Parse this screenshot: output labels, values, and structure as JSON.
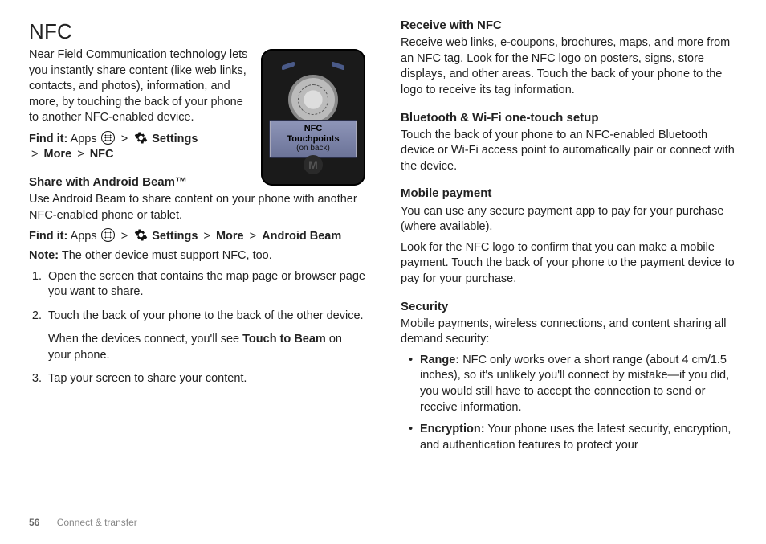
{
  "left": {
    "h1": "NFC",
    "intro": "Near Field Communication technology lets you instantly share content (like web links, contacts, and photos), information, and more, by touching the back of your phone to another NFC-enabled device.",
    "find1_label": "Find it:",
    "find1_apps": "Apps",
    "find1_settings": "Settings",
    "find1_more": "More",
    "find1_nfc": "NFC",
    "h2_beam": "Share with Android Beam™",
    "beam_intro": "Use Android Beam to share content on your phone with another NFC-enabled phone or tablet.",
    "find2_label": "Find it:",
    "find2_apps": "Apps",
    "find2_settings": "Settings",
    "find2_more": "More",
    "find2_ab": "Android Beam",
    "note_label": "Note:",
    "note_text": "The other device must support NFC, too.",
    "step1": "Open the screen that contains the map page or browser page you want to share.",
    "step2": "Touch the back of your phone to the back of the other device.",
    "step2b_a": "When the devices connect, you'll see ",
    "step2b_bold": "Touch to Beam",
    "step2b_c": " on your phone.",
    "step3": "Tap your screen to share your content."
  },
  "right": {
    "h2_recv": "Receive with NFC",
    "recv_text": "Receive web links, e-coupons, brochures, maps, and more from an NFC tag. Look for the NFC logo on posters, signs, store displays, and other areas. Touch the back of your phone to the logo to receive its tag information.",
    "h2_bt": "Bluetooth & Wi-Fi one-touch setup",
    "bt_text": "Touch the back of your phone to an NFC-enabled Bluetooth device or Wi-Fi access point to automatically pair or connect with the device.",
    "h2_pay": "Mobile payment",
    "pay_text1": "You can use any secure payment app to pay for your purchase (where available).",
    "pay_text2": "Look for the NFC logo to confirm that you can make a mobile payment. Touch the back of your phone to the payment device to pay for your purchase.",
    "h2_sec": "Security",
    "sec_intro": "Mobile payments, wireless connections, and content sharing all demand security:",
    "sec_b1_label": "Range:",
    "sec_b1_text": "NFC only works over a short range (about 4 cm/1.5 inches), so it's unlikely you'll connect by mistake—if you did, you would still have to accept the connection to send or receive information.",
    "sec_b2_label": "Encryption:",
    "sec_b2_text": "Your phone uses the latest security, encryption, and authentication features to protect your"
  },
  "phone": {
    "l1": "NFC",
    "l2": "Touchpoints",
    "l3": "(on back)"
  },
  "footer": {
    "page": "56",
    "section": "Connect & transfer"
  },
  "glyph": {
    "gt": ">"
  }
}
